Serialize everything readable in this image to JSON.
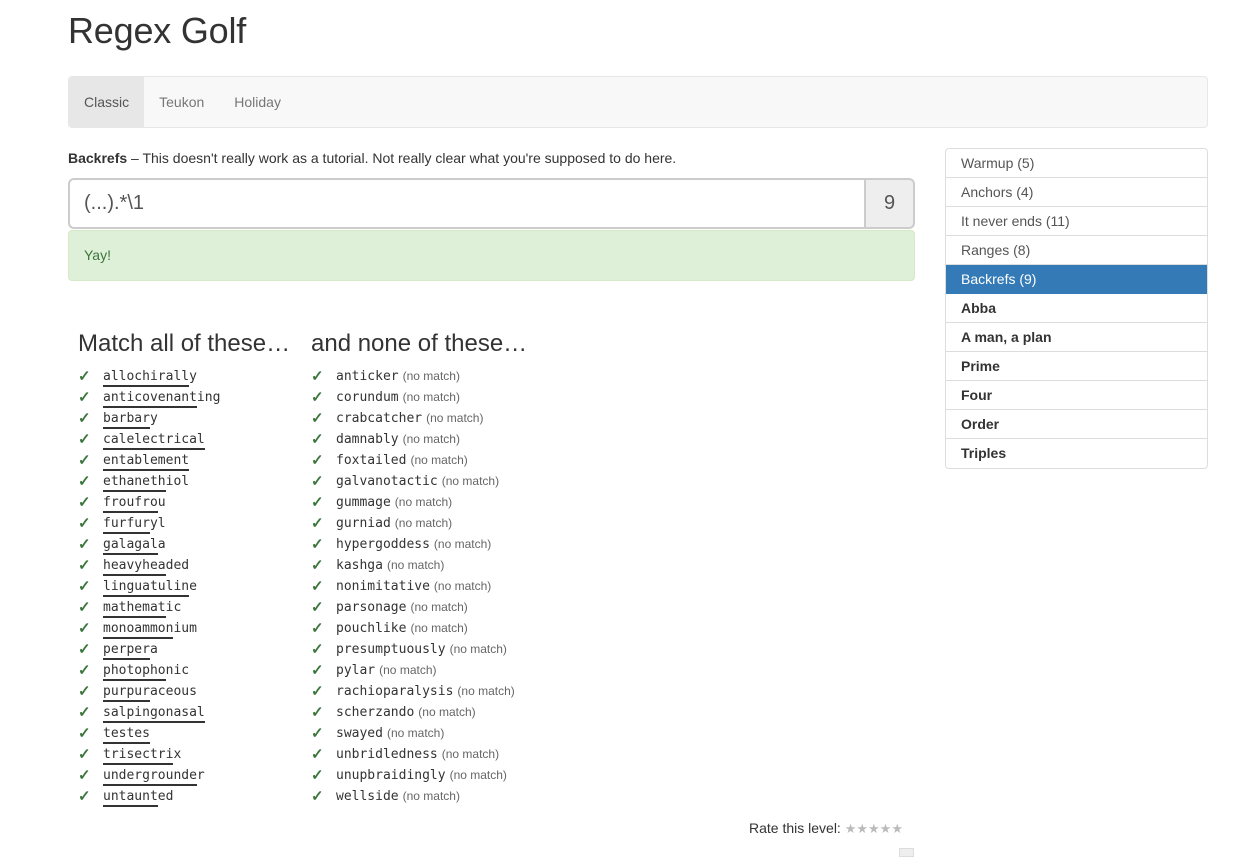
{
  "page": {
    "title": "Regex Golf"
  },
  "nav": {
    "tabs": [
      "Classic",
      "Teukon",
      "Holiday"
    ],
    "active": "Classic"
  },
  "level": {
    "name": "Backrefs",
    "description": " – This doesn't really work as a tutorial. Not really clear what you're supposed to do here."
  },
  "regex": {
    "value": "(...).*\\1",
    "score": "9"
  },
  "alert": {
    "text": "Yay!"
  },
  "match": {
    "heading": "Match all of these…",
    "words": [
      {
        "m": "allochirall",
        "r": "y"
      },
      {
        "m": "anticovenant",
        "r": "ing"
      },
      {
        "m": "barbar",
        "r": "y"
      },
      {
        "m": "calelectrical",
        "r": ""
      },
      {
        "m": "entablement",
        "r": ""
      },
      {
        "m": "ethaneth",
        "r": "iol"
      },
      {
        "m": "froufro",
        "r": "u"
      },
      {
        "m": "furfur",
        "r": "yl"
      },
      {
        "m": "galagal",
        "r": "a"
      },
      {
        "m": "heavyhea",
        "r": "ded"
      },
      {
        "m": "linguatulin",
        "r": "e"
      },
      {
        "m": "mathemat",
        "r": "ic"
      },
      {
        "m": "monoammon",
        "r": "ium"
      },
      {
        "m": "perper",
        "r": "a"
      },
      {
        "m": "photopho",
        "r": "nic"
      },
      {
        "m": "purpur",
        "r": "aceous"
      },
      {
        "m": "salpingonasal",
        "r": ""
      },
      {
        "m": "testes",
        "r": ""
      },
      {
        "m": "trisectri",
        "r": "x"
      },
      {
        "m": "undergrounde",
        "r": "r"
      },
      {
        "m": "untaunt",
        "r": "ed"
      }
    ]
  },
  "nomatch": {
    "heading": "and none of these…",
    "label": "(no match)",
    "words": [
      "anticker",
      "corundum",
      "crabcatcher",
      "damnably",
      "foxtailed",
      "galvanotactic",
      "gummage",
      "gurniad",
      "hypergoddess",
      "kashga",
      "nonimitative",
      "parsonage",
      "pouchlike",
      "presumptuously",
      "pylar",
      "rachioparalysis",
      "scherzando",
      "swayed",
      "unbridledness",
      "unupbraidingly",
      "wellside"
    ]
  },
  "rate": {
    "label": "Rate this level:",
    "stars": "★★★★★"
  },
  "sidebar": {
    "items": [
      {
        "label": "Warmup (5)",
        "state": "normal"
      },
      {
        "label": "Anchors (4)",
        "state": "normal"
      },
      {
        "label": "It never ends (11)",
        "state": "normal"
      },
      {
        "label": "Ranges (8)",
        "state": "normal"
      },
      {
        "label": "Backrefs (9)",
        "state": "active"
      },
      {
        "label": "Abba",
        "state": "bold"
      },
      {
        "label": "A man, a plan",
        "state": "bold"
      },
      {
        "label": "Prime",
        "state": "bold"
      },
      {
        "label": "Four",
        "state": "bold"
      },
      {
        "label": "Order",
        "state": "bold"
      },
      {
        "label": "Triples",
        "state": "bold"
      }
    ]
  },
  "colors": {
    "accent": "#337ab7",
    "success_bg": "#dff0d8",
    "success_text": "#3c763d"
  }
}
